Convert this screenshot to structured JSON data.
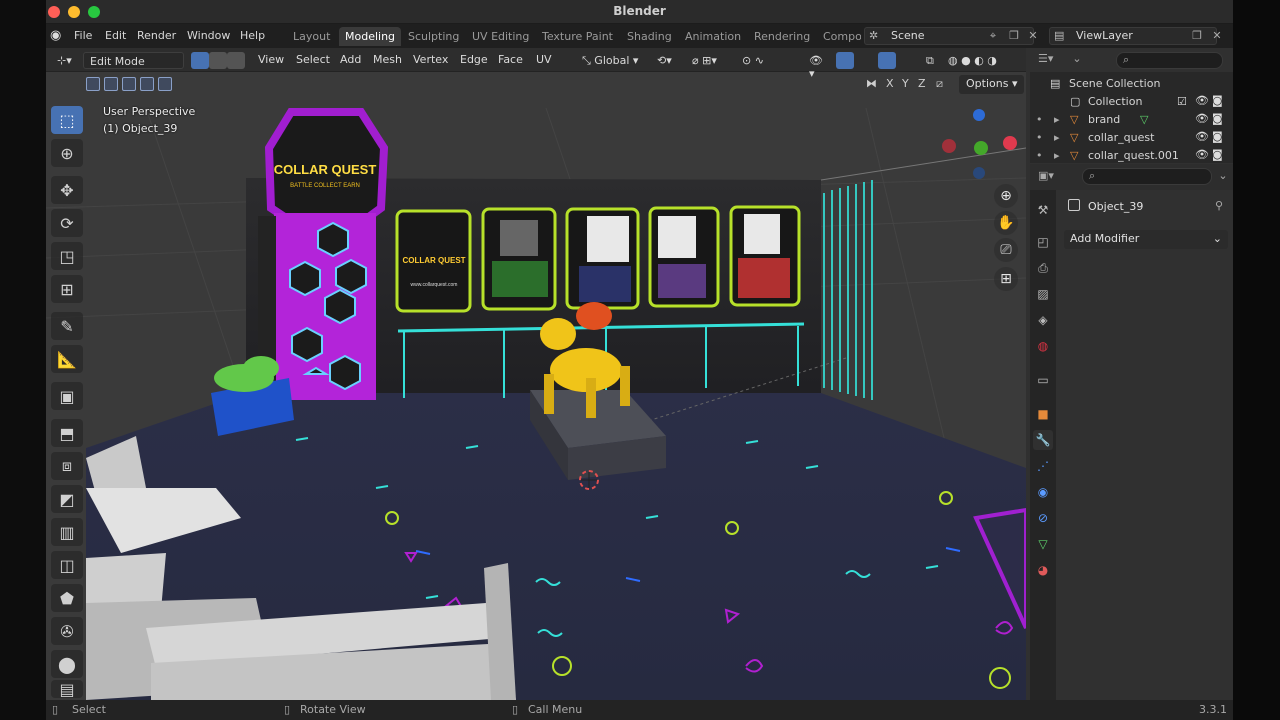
{
  "window": {
    "title": "Blender",
    "version": "3.3.1"
  },
  "menu": [
    "File",
    "Edit",
    "Render",
    "Window",
    "Help"
  ],
  "workspaces": [
    {
      "label": "Layout",
      "active": false
    },
    {
      "label": "Modeling",
      "active": true
    },
    {
      "label": "Sculpting",
      "active": false
    },
    {
      "label": "UV Editing",
      "active": false
    },
    {
      "label": "Texture Paint",
      "active": false
    },
    {
      "label": "Shading",
      "active": false
    },
    {
      "label": "Animation",
      "active": false
    },
    {
      "label": "Rendering",
      "active": false
    },
    {
      "label": "Compo",
      "active": false
    }
  ],
  "scene_field": "Scene",
  "viewlayer_field": "ViewLayer",
  "viewport": {
    "mode": "Edit Mode",
    "menus": [
      "View",
      "Select",
      "Add",
      "Mesh",
      "Vertex",
      "Edge",
      "Face",
      "UV"
    ],
    "orientation": "Global",
    "axes": [
      "X",
      "Y",
      "Z"
    ],
    "options": "Options",
    "perspective": "User Perspective",
    "object_line": "(1) Object_39"
  },
  "poster": {
    "logo_title": "COLLAR QUEST",
    "logo_sub": "BATTLE COLLECT EARN",
    "card_url": "www.collarquest.com"
  },
  "outliner": {
    "root": "Scene Collection",
    "items": [
      {
        "label": "Collection",
        "indent": 0,
        "icon": "collection-icon"
      },
      {
        "label": "brand",
        "indent": 1,
        "icon": "mesh-icon"
      },
      {
        "label": "collar_quest",
        "indent": 1,
        "icon": "mesh-icon"
      },
      {
        "label": "collar_quest.001",
        "indent": 1,
        "icon": "mesh-icon"
      }
    ]
  },
  "properties": {
    "object": "Object_39",
    "add_modifier": "Add Modifier"
  },
  "status": {
    "select": "Select",
    "rotate": "Rotate View",
    "menu": "Call Menu"
  },
  "colors": {
    "accent": "#4772b3",
    "floor": "#2a2d45",
    "neon_green": "#b7e12a",
    "neon_purple": "#a020d0",
    "neon_cyan": "#35e0d8"
  }
}
